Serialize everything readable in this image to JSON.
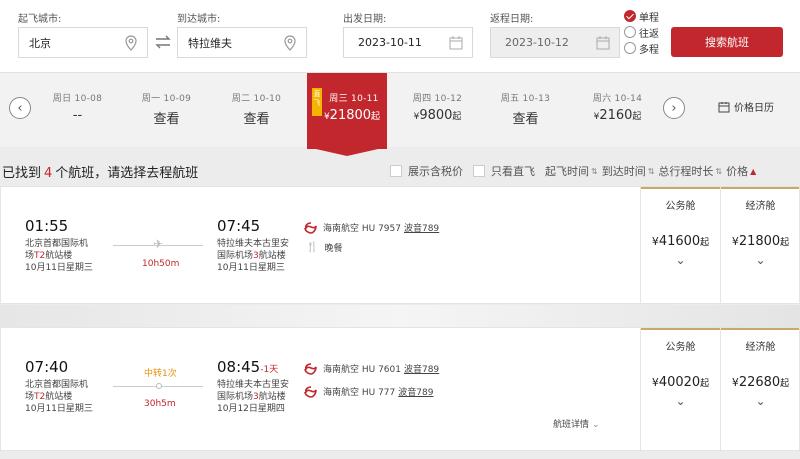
{
  "search": {
    "from_label": "起飞城市:",
    "from_value": "北京",
    "to_label": "到达城市:",
    "to_value": "特拉维夫",
    "depart_label": "出发日期:",
    "depart_value": "2023-10-11",
    "return_label": "返程日期:",
    "return_value": "2023-10-12",
    "trip_types": [
      "单程",
      "往返",
      "多程"
    ],
    "trip_selected": "单程",
    "search_button": "搜索航班"
  },
  "date_strip": {
    "days": [
      {
        "date": "周日 10-08",
        "price": "--"
      },
      {
        "date": "周一 10-09",
        "price": "查看"
      },
      {
        "date": "周二 10-10",
        "price": "查看"
      },
      {
        "date": "周三 10-11",
        "price_symbol": "¥",
        "price": "21800",
        "suffix": "起",
        "selected": true,
        "tag": "直飞"
      },
      {
        "date": "周四 10-12",
        "price_symbol": "¥",
        "price": "9800",
        "suffix": "起"
      },
      {
        "date": "周五 10-13",
        "price": "查看"
      },
      {
        "date": "周六 10-14",
        "price_symbol": "¥",
        "price": "2160",
        "suffix": "起"
      }
    ],
    "calendar_label": "价格日历"
  },
  "result": {
    "prefix": "已找到",
    "count": "4",
    "suffix": "个航班，请选择去程航班"
  },
  "filters": {
    "tax_label": "展示含税价",
    "direct_label": "只看直飞",
    "sorts": [
      "起飞时间",
      "到达时间",
      "总行程时长",
      "价格"
    ]
  },
  "flights": [
    {
      "dep_time": "01:55",
      "dep_airport_1": "北京首都国际机",
      "dep_airport_2a": "场",
      "dep_terminal": "T2",
      "dep_airport_2b": "航站楼",
      "dep_date": "10月11日星期三",
      "duration": "10h50m",
      "arr_time": "07:45",
      "arr_plus": "",
      "arr_airport_1": "特拉维夫本古里安",
      "arr_airport_2a": "国际机场",
      "arr_terminal": "3",
      "arr_airport_2b": "航站楼",
      "arr_date": "10月11日星期三",
      "legs": [
        {
          "airline": "海南航空 HU 7957",
          "aircraft": "波音789"
        }
      ],
      "meal": "晚餐",
      "business_label": "公务舱",
      "business_price": "41600",
      "economy_label": "经济舱",
      "economy_price": "21800",
      "currency": "¥",
      "qi": "起"
    },
    {
      "dep_time": "07:40",
      "dep_airport_1": "北京首都国际机",
      "dep_airport_2a": "场",
      "dep_terminal": "T2",
      "dep_airport_2b": "航站楼",
      "dep_date": "10月11日星期三",
      "stopover": "中转1次",
      "duration": "30h5m",
      "arr_time": "08:45",
      "arr_plus": "-1天",
      "arr_airport_1": "特拉维夫本古里安",
      "arr_airport_2a": "国际机场",
      "arr_terminal": "3",
      "arr_airport_2b": "航站楼",
      "arr_date": "10月12日星期四",
      "legs": [
        {
          "airline": "海南航空 HU 7601",
          "aircraft": "波音789"
        },
        {
          "airline": "海南航空 HU 777",
          "aircraft": "波音789"
        }
      ],
      "detail_link": "航班详情",
      "business_label": "公务舱",
      "business_price": "40020",
      "economy_label": "经济舱",
      "economy_price": "22680",
      "currency": "¥",
      "qi": "起"
    }
  ],
  "colors": {
    "brand_red": "#c1272d",
    "stopover_orange": "#e8900c",
    "gold": "#c9a86a"
  }
}
